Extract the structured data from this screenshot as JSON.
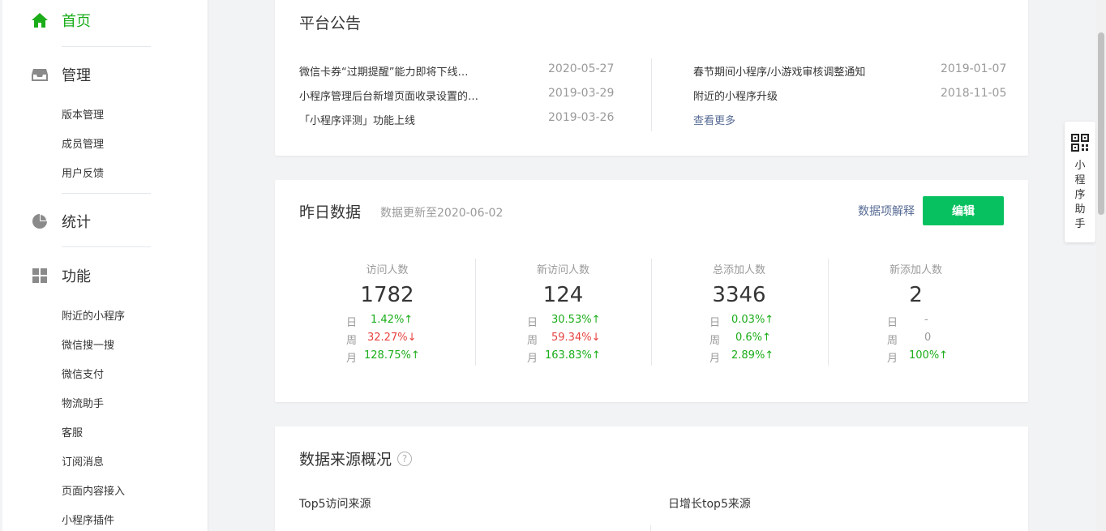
{
  "sidebar": {
    "home": "首页",
    "manage": {
      "title": "管理",
      "items": [
        "版本管理",
        "成员管理",
        "用户反馈"
      ]
    },
    "stats": {
      "title": "统计"
    },
    "features": {
      "title": "功能",
      "items": [
        "附近的小程序",
        "微信搜一搜",
        "微信支付",
        "物流助手",
        "客服",
        "订阅消息",
        "页面内容接入",
        "小程序插件"
      ]
    }
  },
  "announcement": {
    "title": "平台公告",
    "left": [
      {
        "title": "微信卡券“过期提醒”能力即将下线…",
        "date": "2020-05-27"
      },
      {
        "title": "小程序管理后台新增页面收录设置的…",
        "date": "2019-03-29"
      },
      {
        "title": "「小程序评测」功能上线",
        "date": "2019-03-26"
      }
    ],
    "right": [
      {
        "title": "春节期间小程序/小游戏审核调整通知",
        "date": "2019-01-07"
      },
      {
        "title": "附近的小程序升级",
        "date": "2018-11-05"
      }
    ],
    "more": "查看更多"
  },
  "yesterday": {
    "title": "昨日数据",
    "subtitle": "数据更新至2020-06-02",
    "explain_link": "数据项解释",
    "edit_button": "编辑",
    "period_labels": {
      "day": "日",
      "week": "周",
      "month": "月"
    },
    "metrics": [
      {
        "label": "访问人数",
        "value": "1782",
        "day": "1.42%↑",
        "week": "32.27%↓",
        "month": "128.75%↑"
      },
      {
        "label": "新访问人数",
        "value": "124",
        "day": "30.53%↑",
        "week": "59.34%↓",
        "month": "163.83%↑"
      },
      {
        "label": "总添加人数",
        "value": "3346",
        "day": "0.03%↑",
        "week": "0.6%↑",
        "month": "2.89%↑"
      },
      {
        "label": "新添加人数",
        "value": "2",
        "day": "-",
        "week": "0",
        "month": "100%↑"
      }
    ]
  },
  "sources": {
    "title": "数据来源概况",
    "left_label": "Top5访问来源",
    "right_label": "日增长top5来源"
  },
  "helper": {
    "label": "小程序助手"
  },
  "colors": {
    "accent": "#1aad19",
    "button": "#07c160",
    "down": "#e64340",
    "link": "#576b95"
  }
}
